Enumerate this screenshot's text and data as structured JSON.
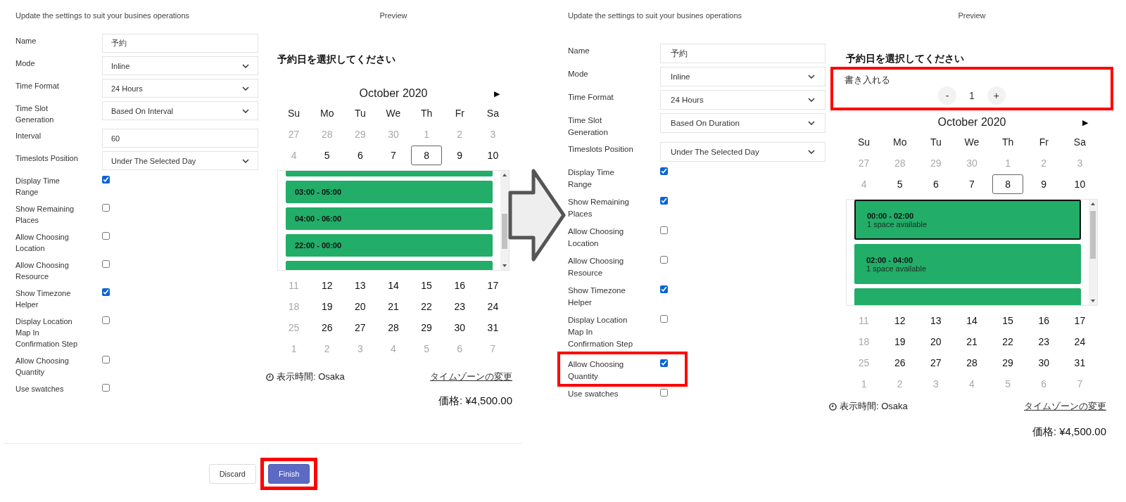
{
  "panels": [
    {
      "header": "Update the settings to suit your busines operations",
      "preview_title": "Preview",
      "fields": [
        {
          "kind": "text",
          "label": "Name",
          "value": "予約",
          "highlighted": false
        },
        {
          "kind": "select",
          "label": "Mode",
          "value": "Inline",
          "highlighted": false
        },
        {
          "kind": "select",
          "label": "Time Format",
          "value": "24 Hours",
          "highlighted": false
        },
        {
          "kind": "select",
          "label": "Time Slot Generation",
          "value": "Based On Interval",
          "highlighted": false
        },
        {
          "kind": "text",
          "label": "Interval",
          "value": "60",
          "highlighted": false
        },
        {
          "kind": "select",
          "label": "Timeslots Position",
          "value": "Under The Selected Day",
          "highlighted": false
        },
        {
          "kind": "checkbox",
          "label": "Display Time Range",
          "checked": true,
          "highlighted": false
        },
        {
          "kind": "checkbox",
          "label": "Show Remaining Places",
          "checked": false,
          "highlighted": false
        },
        {
          "kind": "checkbox",
          "label": "Allow Choosing Location",
          "checked": false,
          "highlighted": false
        },
        {
          "kind": "checkbox",
          "label": "Allow Choosing Resource",
          "checked": false,
          "highlighted": false
        },
        {
          "kind": "checkbox",
          "label": "Show Timezone Helper",
          "checked": true,
          "highlighted": false
        },
        {
          "kind": "checkbox",
          "label": "Display Location Map In Confirmation Step",
          "checked": false,
          "highlighted": false
        },
        {
          "kind": "checkbox",
          "label": "Allow Choosing Quantity",
          "checked": false,
          "highlighted": false
        },
        {
          "kind": "checkbox",
          "label": "Use swatches",
          "checked": false,
          "highlighted": false
        }
      ],
      "booking": {
        "title": "予約日を選択してください",
        "month": "October 2020",
        "next": "▶",
        "weekdays": [
          "Su",
          "Mo",
          "Tu",
          "We",
          "Th",
          "Fr",
          "Sa"
        ],
        "weeks": [
          {
            "days": [
              {
                "label": "27",
                "muted": true,
                "selected": false
              },
              {
                "label": "28",
                "muted": true,
                "selected": false
              },
              {
                "label": "29",
                "muted": true,
                "selected": false
              },
              {
                "label": "30",
                "muted": true,
                "selected": false
              },
              {
                "label": "1",
                "muted": true,
                "selected": false
              },
              {
                "label": "2",
                "muted": true,
                "selected": false
              },
              {
                "label": "3",
                "muted": true,
                "selected": false
              }
            ]
          },
          {
            "days": [
              {
                "label": "4",
                "muted": true,
                "selected": false
              },
              {
                "label": "5",
                "muted": false,
                "selected": false
              },
              {
                "label": "6",
                "muted": false,
                "selected": false
              },
              {
                "label": "7",
                "muted": false,
                "selected": false
              },
              {
                "label": "8",
                "muted": false,
                "selected": true
              },
              {
                "label": "9",
                "muted": false,
                "selected": false
              },
              {
                "label": "10",
                "muted": false,
                "selected": false
              }
            ],
            "slots": [
              {
                "kind": "partial",
                "selected": false
              },
              {
                "kind": "slot",
                "time": "03:00 - 05:00",
                "selected": false
              },
              {
                "kind": "slot",
                "time": "04:00 - 06:00",
                "selected": false
              },
              {
                "kind": "slot",
                "time": "22:00 - 00:00",
                "selected": false
              },
              {
                "kind": "partial",
                "selected": false
              }
            ]
          },
          {
            "days": [
              {
                "label": "11",
                "muted": true,
                "selected": false
              },
              {
                "label": "12",
                "muted": false,
                "selected": false
              },
              {
                "label": "13",
                "muted": false,
                "selected": false
              },
              {
                "label": "14",
                "muted": false,
                "selected": false
              },
              {
                "label": "15",
                "muted": false,
                "selected": false
              },
              {
                "label": "16",
                "muted": false,
                "selected": false
              },
              {
                "label": "17",
                "muted": false,
                "selected": false
              }
            ]
          },
          {
            "days": [
              {
                "label": "18",
                "muted": true,
                "selected": false
              },
              {
                "label": "19",
                "muted": false,
                "selected": false
              },
              {
                "label": "20",
                "muted": false,
                "selected": false
              },
              {
                "label": "21",
                "muted": false,
                "selected": false
              },
              {
                "label": "22",
                "muted": false,
                "selected": false
              },
              {
                "label": "23",
                "muted": false,
                "selected": false
              },
              {
                "label": "24",
                "muted": false,
                "selected": false
              }
            ]
          },
          {
            "days": [
              {
                "label": "25",
                "muted": true,
                "selected": false
              },
              {
                "label": "26",
                "muted": false,
                "selected": false
              },
              {
                "label": "27",
                "muted": false,
                "selected": false
              },
              {
                "label": "28",
                "muted": false,
                "selected": false
              },
              {
                "label": "29",
                "muted": false,
                "selected": false
              },
              {
                "label": "30",
                "muted": false,
                "selected": false
              },
              {
                "label": "31",
                "muted": false,
                "selected": false
              }
            ]
          },
          {
            "days": [
              {
                "label": "1",
                "muted": true,
                "selected": false
              },
              {
                "label": "2",
                "muted": true,
                "selected": false
              },
              {
                "label": "3",
                "muted": true,
                "selected": false
              },
              {
                "label": "4",
                "muted": true,
                "selected": false
              },
              {
                "label": "5",
                "muted": true,
                "selected": false
              },
              {
                "label": "6",
                "muted": true,
                "selected": false
              },
              {
                "label": "7",
                "muted": true,
                "selected": false
              }
            ]
          }
        ],
        "timezone": "表示時間: Osaka",
        "timezone_link": "タイムゾーンの変更",
        "price": "価格: ¥4,500.00"
      },
      "footer": {
        "buttons": [
          {
            "kind": "secondary",
            "label": "Discard",
            "highlighted": false
          },
          {
            "kind": "primary",
            "label": "Finish",
            "highlighted": true
          }
        ]
      }
    },
    {
      "header": "Update the settings to suit your busines operations",
      "preview_title": "Preview",
      "fields": [
        {
          "kind": "text",
          "label": "Name",
          "value": "予約",
          "highlighted": false
        },
        {
          "kind": "select",
          "label": "Mode",
          "value": "Inline",
          "highlighted": false
        },
        {
          "kind": "select",
          "label": "Time Format",
          "value": "24 Hours",
          "highlighted": false
        },
        {
          "kind": "select",
          "label": "Time Slot Generation",
          "value": "Based On Duration",
          "highlighted": false
        },
        {
          "kind": "select",
          "label": "Timeslots Position",
          "value": "Under The Selected Day",
          "highlighted": false
        },
        {
          "kind": "checkbox",
          "label": "Display Time Range",
          "checked": true,
          "highlighted": false
        },
        {
          "kind": "checkbox",
          "label": "Show Remaining Places",
          "checked": true,
          "highlighted": false
        },
        {
          "kind": "checkbox",
          "label": "Allow Choosing Location",
          "checked": false,
          "highlighted": false
        },
        {
          "kind": "checkbox",
          "label": "Allow Choosing Resource",
          "checked": false,
          "highlighted": false
        },
        {
          "kind": "checkbox",
          "label": "Show Timezone Helper",
          "checked": true,
          "highlighted": false
        },
        {
          "kind": "checkbox",
          "label": "Display Location Map In Confirmation Step",
          "checked": false,
          "highlighted": false
        },
        {
          "kind": "checkbox",
          "label": "Allow Choosing Quantity",
          "checked": true,
          "highlighted": true
        },
        {
          "kind": "checkbox",
          "label": "Use swatches",
          "checked": false,
          "highlighted": false
        }
      ],
      "booking": {
        "title": "予約日を選択してください",
        "quantity": {
          "label": "書き入れる",
          "minus": "-",
          "value": "1",
          "plus": "+",
          "highlighted": true
        },
        "month": "October 2020",
        "next": "▶",
        "weekdays": [
          "Su",
          "Mo",
          "Tu",
          "We",
          "Th",
          "Fr",
          "Sa"
        ],
        "weeks": [
          {
            "days": [
              {
                "label": "27",
                "muted": true,
                "selected": false
              },
              {
                "label": "28",
                "muted": true,
                "selected": false
              },
              {
                "label": "29",
                "muted": true,
                "selected": false
              },
              {
                "label": "30",
                "muted": true,
                "selected": false
              },
              {
                "label": "1",
                "muted": true,
                "selected": false
              },
              {
                "label": "2",
                "muted": true,
                "selected": false
              },
              {
                "label": "3",
                "muted": true,
                "selected": false
              }
            ]
          },
          {
            "days": [
              {
                "label": "4",
                "muted": true,
                "selected": false
              },
              {
                "label": "5",
                "muted": false,
                "selected": false
              },
              {
                "label": "6",
                "muted": false,
                "selected": false
              },
              {
                "label": "7",
                "muted": false,
                "selected": false
              },
              {
                "label": "8",
                "muted": false,
                "selected": true
              },
              {
                "label": "9",
                "muted": false,
                "selected": false
              },
              {
                "label": "10",
                "muted": false,
                "selected": false
              }
            ],
            "slots": [
              {
                "kind": "slot",
                "time": "00:00 - 02:00",
                "note": "1 space available",
                "selected": true
              },
              {
                "kind": "slot",
                "time": "02:00 - 04:00",
                "note": "1 space available",
                "selected": false
              },
              {
                "kind": "partial",
                "selected": false
              }
            ]
          },
          {
            "days": [
              {
                "label": "11",
                "muted": true,
                "selected": false
              },
              {
                "label": "12",
                "muted": false,
                "selected": false
              },
              {
                "label": "13",
                "muted": false,
                "selected": false
              },
              {
                "label": "14",
                "muted": false,
                "selected": false
              },
              {
                "label": "15",
                "muted": false,
                "selected": false
              },
              {
                "label": "16",
                "muted": false,
                "selected": false
              },
              {
                "label": "17",
                "muted": false,
                "selected": false
              }
            ]
          },
          {
            "days": [
              {
                "label": "18",
                "muted": true,
                "selected": false
              },
              {
                "label": "19",
                "muted": false,
                "selected": false
              },
              {
                "label": "20",
                "muted": false,
                "selected": false
              },
              {
                "label": "21",
                "muted": false,
                "selected": false
              },
              {
                "label": "22",
                "muted": false,
                "selected": false
              },
              {
                "label": "23",
                "muted": false,
                "selected": false
              },
              {
                "label": "24",
                "muted": false,
                "selected": false
              }
            ]
          },
          {
            "days": [
              {
                "label": "25",
                "muted": true,
                "selected": false
              },
              {
                "label": "26",
                "muted": false,
                "selected": false
              },
              {
                "label": "27",
                "muted": false,
                "selected": false
              },
              {
                "label": "28",
                "muted": false,
                "selected": false
              },
              {
                "label": "29",
                "muted": false,
                "selected": false
              },
              {
                "label": "30",
                "muted": false,
                "selected": false
              },
              {
                "label": "31",
                "muted": false,
                "selected": false
              }
            ]
          },
          {
            "days": [
              {
                "label": "1",
                "muted": true,
                "selected": false
              },
              {
                "label": "2",
                "muted": true,
                "selected": false
              },
              {
                "label": "3",
                "muted": true,
                "selected": false
              },
              {
                "label": "4",
                "muted": true,
                "selected": false
              },
              {
                "label": "5",
                "muted": true,
                "selected": false
              },
              {
                "label": "6",
                "muted": true,
                "selected": false
              },
              {
                "label": "7",
                "muted": true,
                "selected": false
              }
            ]
          }
        ],
        "timezone": "表示時間: Osaka",
        "timezone_link": "タイムゾーンの変更",
        "price": "価格: ¥4,500.00"
      }
    }
  ]
}
